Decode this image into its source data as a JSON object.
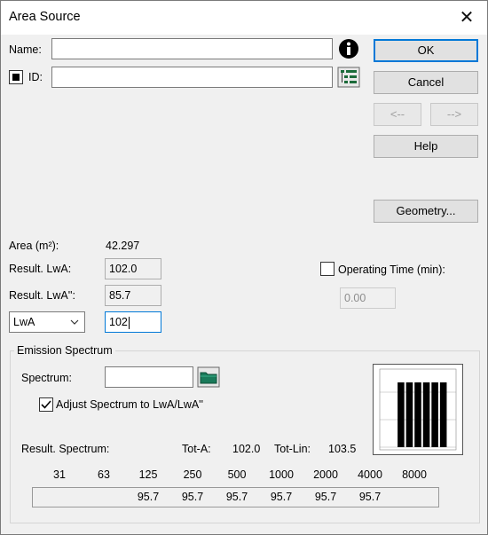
{
  "window": {
    "title": "Area Source"
  },
  "name": {
    "label": "Name:",
    "value": ""
  },
  "id": {
    "label": "ID:",
    "value": ""
  },
  "buttons": {
    "ok": "OK",
    "cancel": "Cancel",
    "prev": "<--",
    "next": "-->",
    "help": "Help",
    "geometry": "Geometry..."
  },
  "area": {
    "label": "Area (m²):",
    "value": "42.297"
  },
  "result_lwa": {
    "label": "Result. LwA:",
    "value": "102.0"
  },
  "result_lwa2": {
    "label": "Result. LwA'':",
    "value": "85.7"
  },
  "input": {
    "select_value": "LwA",
    "value": "102"
  },
  "operating_time": {
    "label": "Operating Time (min):",
    "value": "0.00",
    "checked": false
  },
  "emission": {
    "title": "Emission Spectrum",
    "spectrum_label": "Spectrum:",
    "spectrum_value": "",
    "adjust_label": "Adjust Spectrum to LwA/LwA''",
    "adjust_checked": true,
    "result_label": "Result. Spectrum:",
    "tota_label": "Tot-A:",
    "tota_value": "102.0",
    "totlin_label": "Tot-Lin:",
    "totlin_value": "103.5",
    "bands": [
      "31",
      "63",
      "125",
      "250",
      "500",
      "1000",
      "2000",
      "4000",
      "8000"
    ],
    "values": [
      "",
      "",
      "95.7",
      "95.7",
      "95.7",
      "95.7",
      "95.7",
      "95.7",
      ""
    ]
  }
}
